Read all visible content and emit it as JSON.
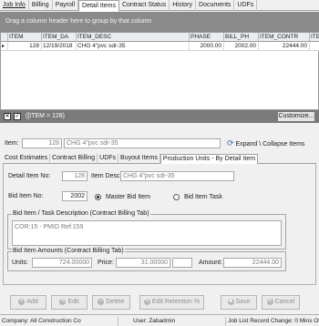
{
  "tabs": [
    {
      "label": "Job Info"
    },
    {
      "label": "Billing"
    },
    {
      "label": "Payroll"
    },
    {
      "label": "Detail Items"
    },
    {
      "label": "Contract Status"
    },
    {
      "label": "History"
    },
    {
      "label": "Documents"
    },
    {
      "label": "UDFs"
    }
  ],
  "group_hint": "Drag a column header here to group by that column",
  "grid": {
    "columns": [
      "ITEM",
      "ITEM_DA",
      "ITEM_DESC",
      "PHASE",
      "BILL_PH",
      "ITEM_CONTR",
      "ITE"
    ],
    "rows": [
      {
        "marker": "▸",
        "item": "128",
        "item_date": "12/19/2018",
        "item_desc": "CHG 4\"pvc sdr-35",
        "phase": "2000.00",
        "bill_phase": "2002.00",
        "item_contract": "22444.00"
      }
    ]
  },
  "filter": {
    "check1": "✕",
    "check2": "✓",
    "text": "([ITEM = 128)",
    "customize_label": "Customize..."
  },
  "item_row": {
    "label": "Item:",
    "number": "128",
    "desc": "CHG 4\"pvc sdr-35",
    "expand_label": "Expand \\ Collapse Items"
  },
  "subtabs": [
    {
      "label": "Cost Estimates"
    },
    {
      "label": "Contract Billing"
    },
    {
      "label": "UDFs"
    },
    {
      "label": "Buyout Items"
    },
    {
      "label": "Production Units - By Detail Item"
    }
  ],
  "detail": {
    "detail_item_no_label": "Detail Item No:",
    "detail_item_no": "128",
    "item_desc_label": "Item Desc:",
    "item_desc": "CHG 4\"pvc sdr-35",
    "bid_item_no_label": "Bid Item No:",
    "bid_item_no": "2002",
    "master_label": "Master Bid Item",
    "task_label": "Bid Item Task",
    "desc_group_title": "Bid Item / Task Description (Contract Billing Tab)",
    "desc_text": "COR:15 - PMID Ref:159",
    "amounts_group_title": "Bid Item Amounts (Contract Billing Tab)",
    "units_label": "Units:",
    "units": "724.00000",
    "price_label": "Price:",
    "price": "31.00000",
    "amount_label": "Amount:",
    "amount": "22444.00"
  },
  "buttons": {
    "add": "Add",
    "edit": "Edit",
    "delete": "Delete",
    "edit_retention": "Edit Retention %",
    "save": "Save",
    "cancel": "Cancel"
  },
  "status": {
    "company": "Company: All Construction Co",
    "user": "User: Zabadmin",
    "record": "Job List Record Change: 0 Mins Old"
  }
}
